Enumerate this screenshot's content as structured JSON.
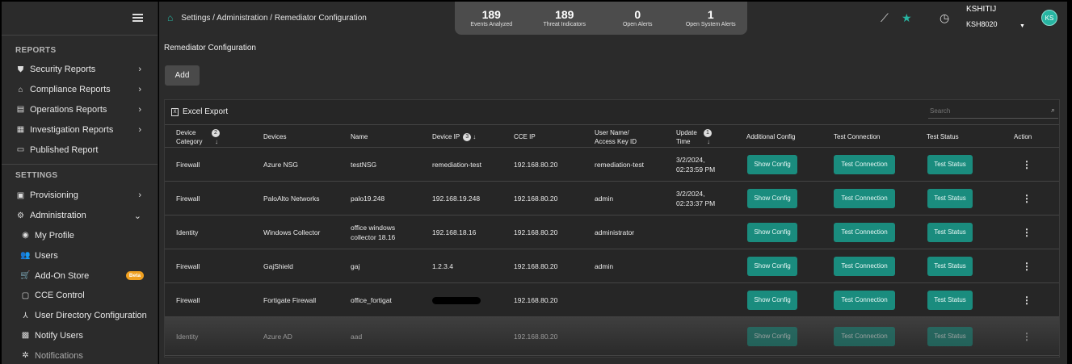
{
  "sidebar": {
    "reports_heading": "REPORTS",
    "reports": [
      {
        "label": "Security Reports",
        "icon": "shield-icon"
      },
      {
        "label": "Compliance Reports",
        "icon": "bank-icon"
      },
      {
        "label": "Operations Reports",
        "icon": "document-icon"
      },
      {
        "label": "Investigation Reports",
        "icon": "report-icon"
      },
      {
        "label": "Published Report",
        "icon": "laptop-icon"
      }
    ],
    "settings_heading": "SETTINGS",
    "settings": [
      {
        "label": "Provisioning",
        "icon": "provisioning-icon"
      },
      {
        "label": "Administration",
        "icon": "administration-icon"
      }
    ],
    "admin_items": [
      {
        "label": "My Profile",
        "icon": "profile-icon"
      },
      {
        "label": "Users",
        "icon": "users-icon"
      },
      {
        "label": "Add-On Store",
        "icon": "cart-icon",
        "badge": "Beta"
      },
      {
        "label": "CCE Control",
        "icon": "control-icon"
      },
      {
        "label": "User Directory Configuration",
        "icon": "directory-icon"
      },
      {
        "label": "Notify Users",
        "icon": "notify-icon"
      },
      {
        "label": "Notifications",
        "icon": "bell-icon"
      }
    ]
  },
  "header": {
    "breadcrumb": "Settings / Administration / Remediator Configuration",
    "stats": [
      {
        "value": "189",
        "label": "Events Analyzed"
      },
      {
        "value": "189",
        "label": "Threat Indicators"
      },
      {
        "value": "0",
        "label": "Open Alerts"
      },
      {
        "value": "1",
        "label": "Open System Alerts"
      }
    ],
    "user_name": "KSHITIJ",
    "user_code": "KSH8020",
    "avatar_initials": "KS"
  },
  "main": {
    "title": "Remediator Configuration",
    "add_label": "Add",
    "excel_label": "Excel Export",
    "search_placeholder": "Search",
    "columns": {
      "device_category": "Device Category",
      "devices": "Devices",
      "name": "Name",
      "device_ip": "Device IP",
      "cce_ip": "CCE IP",
      "user_name": "User Name/ Access Key ID",
      "update_time": "Update Time",
      "additional_config": "Additional Config",
      "test_connection": "Test Connection",
      "test_status": "Test Status",
      "action": "Action"
    },
    "sort_badges": {
      "device_category": "2",
      "device_ip": "3",
      "update_time": "1"
    },
    "button_labels": {
      "show_config": "Show Config",
      "test_connection": "Test Connection",
      "test_status": "Test Status"
    },
    "rows": [
      {
        "category": "Firewall",
        "device": "Azure NSG",
        "name": "testNSG",
        "device_ip": "remediation-test",
        "cce_ip": "192.168.80.20",
        "user": "remediation-test",
        "update_date": "3/2/2024,",
        "update_time": "02:23:59 PM"
      },
      {
        "category": "Firewall",
        "device": "PaloAlto Networks",
        "name": "palo19.248",
        "device_ip": "192.168.19.248",
        "cce_ip": "192.168.80.20",
        "user": "admin",
        "update_date": "3/2/2024,",
        "update_time": "02:23:37 PM"
      },
      {
        "category": "Identity",
        "device": "Windows Collector",
        "name": "office windows collector 18.16",
        "device_ip": "192.168.18.16",
        "cce_ip": "192.168.80.20",
        "user": "administrator",
        "update_date": "",
        "update_time": ""
      },
      {
        "category": "Firewall",
        "device": "GajShield",
        "name": "gaj",
        "device_ip": "1.2.3.4",
        "cce_ip": "192.168.80.20",
        "user": "admin",
        "update_date": "",
        "update_time": ""
      },
      {
        "category": "Firewall",
        "device": "Fortigate Firewall",
        "name": "office_fortigat",
        "device_ip": "",
        "cce_ip": "192.168.80.20",
        "user": "",
        "update_date": "",
        "update_time": ""
      },
      {
        "category": "Identity",
        "device": "Azure AD",
        "name": "aad",
        "device_ip": "",
        "cce_ip": "192.168.80.20",
        "user": "",
        "update_date": "",
        "update_time": ""
      }
    ]
  },
  "colors": {
    "accent": "#1a8c7e",
    "teal_icon": "#27b5a2",
    "beta": "#f0a020"
  }
}
